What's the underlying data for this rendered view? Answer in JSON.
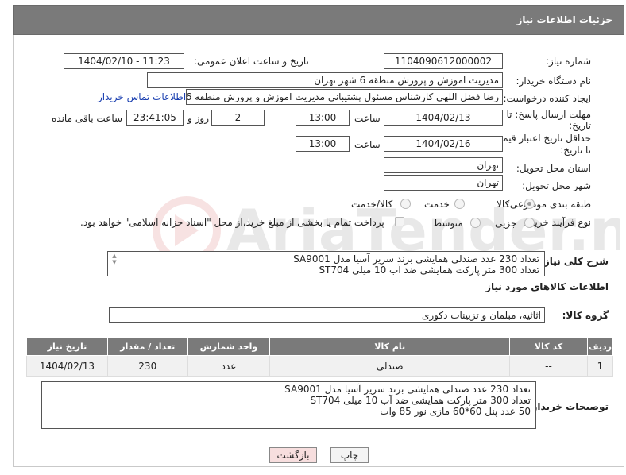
{
  "header": {
    "title": "جزئیات اطلاعات نیاز"
  },
  "fields": {
    "need_number_label": "شماره نیاز:",
    "need_number": "1104090612000002",
    "announce_label": "تاریخ و ساعت اعلان عمومی:",
    "announce_value": "1404/02/10 - 11:23",
    "buyer_org_label": "نام دستگاه خریدار:",
    "buyer_org": "مدیریت اموزش و پرورش منطقه 6 شهر تهران",
    "creator_label": "ایجاد کننده درخواست:",
    "creator": "رضا فضل اللهی کارشناس مسئول پشتیبانی  مدیریت اموزش و پرورش منطقه 6",
    "contact_link": "اطلاعات تماس خریدار",
    "reply_deadline_label_1": "مهلت ارسال پاسخ: تا",
    "reply_deadline_label_2": "تاریخ:",
    "reply_date": "1404/02/13",
    "time_label": "ساعت",
    "reply_time": "13:00",
    "days_value": "2",
    "days_label": "روز و",
    "remaining_time": "23:41:05",
    "remaining_label": "ساعت باقی مانده",
    "price_validity_label_1": "حداقل تاریخ اعتبار قیمت:",
    "price_validity_label_2": "تا تاریخ:",
    "price_date": "1404/02/16",
    "price_time": "13:00",
    "province_label": "استان محل تحویل:",
    "province": "تهران",
    "city_label": "شهر محل تحویل:",
    "city": "تهران",
    "category_label": "طبقه بندی موضوعی:",
    "category_options": [
      "کالا",
      "خدمت",
      "کالا/خدمت"
    ],
    "process_label": "نوع فرآیند خرید :",
    "process_options": [
      "جزیی",
      "متوسط"
    ],
    "payment_note": "پرداخت تمام یا بخشی از مبلغ خرید،از محل \"اسناد خزانه اسلامی\" خواهد بود."
  },
  "summary": {
    "label": "شرح کلی نیاز:",
    "lines": [
      "تعداد 230 عدد صندلی همایشی برند سریر آسیا مدل SA9001",
      "تعداد 300 متر پارکت همایشی ضد آب 10 میلی ST704"
    ]
  },
  "goods_section": {
    "title": "اطلاعات کالاهای مورد نیاز",
    "group_label": "گروه کالا:",
    "group_value": "اثاثیه، مبلمان و تزیینات دکوری"
  },
  "table": {
    "columns": [
      "ردیف",
      "کد کالا",
      "نام کالا",
      "واحد شمارش",
      "تعداد / مقدار",
      "تاریخ نیاز"
    ],
    "rows": [
      [
        "1",
        "--",
        "صندلی",
        "عدد",
        "230",
        "1404/02/13"
      ]
    ]
  },
  "buyer_notes": {
    "label": "توضیحات خریدار:",
    "lines": [
      "تعداد 230 عدد صندلی همایشی برند سریر آسیا مدل SA9001",
      "تعداد 300 متر پارکت همایشی ضد آب 10 میلی ST704",
      "50 عدد پنل 60*60 مازی نور 85 وات"
    ]
  },
  "buttons": {
    "print": "چاپ",
    "back": "بازگشت"
  },
  "watermark": {
    "text": "AriaTender.neT"
  }
}
